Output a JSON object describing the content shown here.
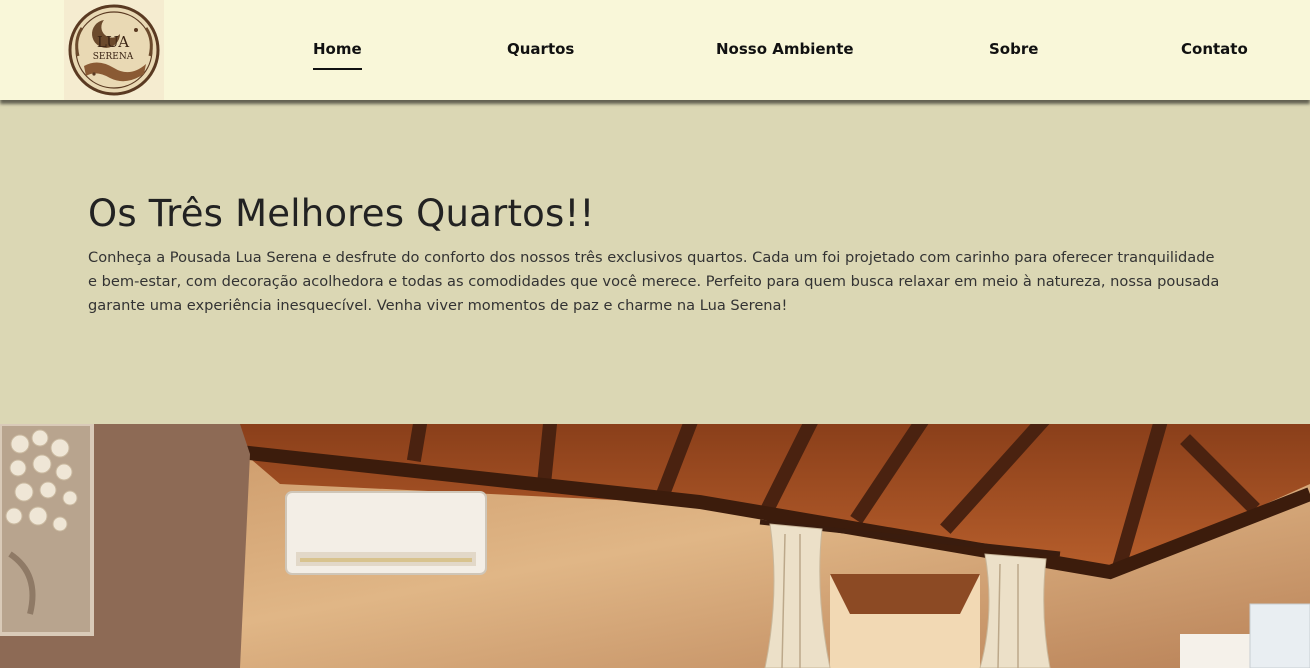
{
  "brand": {
    "logo_line1": "LUA",
    "logo_line2": "SERENA"
  },
  "nav": {
    "items": [
      {
        "label": "Home",
        "active": true
      },
      {
        "label": "Quartos",
        "active": false
      },
      {
        "label": "Nosso Ambiente",
        "active": false
      },
      {
        "label": "Sobre",
        "active": false
      },
      {
        "label": "Contato",
        "active": false
      }
    ]
  },
  "hero": {
    "title": "Os Três Melhores Quartos!!",
    "text": "Conheça a Pousada Lua Serena e desfrute do conforto dos nossos três exclusivos quartos. Cada um foi projetado com carinho para oferecer tranquilidade e bem-estar, com decoração acolhedora e todas as comodidades que você merece. Perfeito para quem busca relaxar em meio à natureza, nossa pousada garante uma experiência inesquecível. Venha viver momentos de paz e charme na Lua Serena!"
  },
  "colors": {
    "navbar_bg": "#f9f7d9",
    "hero_bg": "#dbd7b4",
    "text_dark": "#222222"
  }
}
